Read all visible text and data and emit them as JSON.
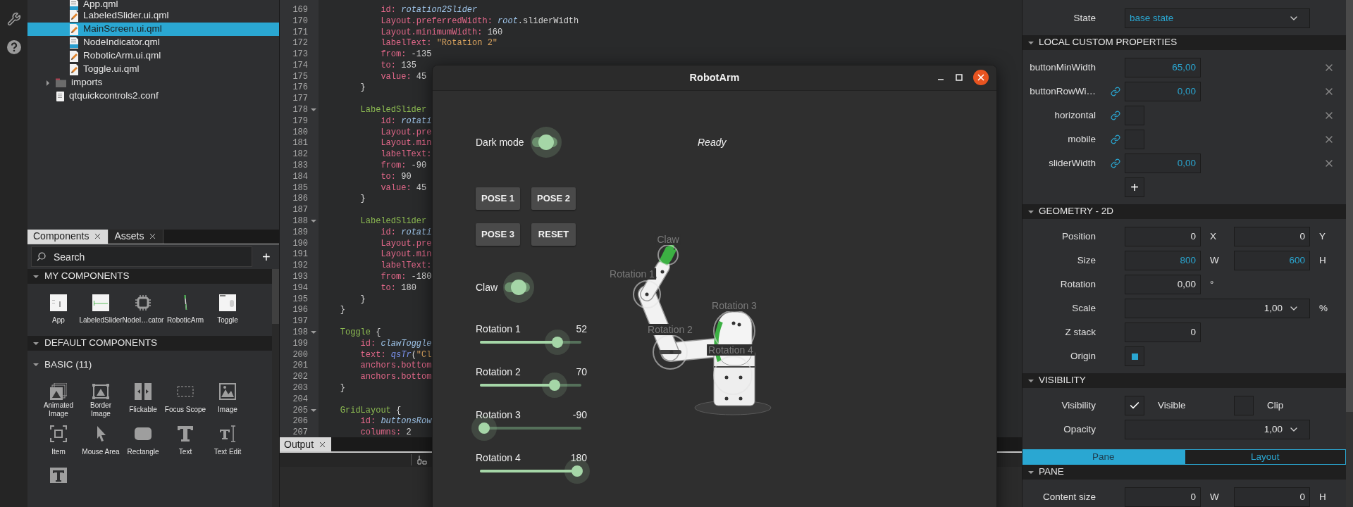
{
  "project_tree": {
    "nested_items": [
      {
        "label": "App.qml",
        "kind": "qml",
        "selected": false
      },
      {
        "label": "LabeledSlider.ui.qml",
        "kind": "uiqml",
        "selected": false
      },
      {
        "label": "MainScreen.ui.qml",
        "kind": "uiqml",
        "selected": true
      },
      {
        "label": "NodeIndicator.qml",
        "kind": "qml",
        "selected": false
      },
      {
        "label": "RoboticArm.ui.qml",
        "kind": "uiqml",
        "selected": false
      },
      {
        "label": "Toggle.ui.qml",
        "kind": "uiqml",
        "selected": false
      }
    ],
    "items": [
      {
        "label": "imports",
        "kind": "folder",
        "expanded": false,
        "selected": false
      },
      {
        "label": "qtquickcontrols2.conf",
        "kind": "file",
        "selected": false
      }
    ]
  },
  "library": {
    "tabs": [
      {
        "label": "Components",
        "selected": true
      },
      {
        "label": "Assets",
        "selected": false
      }
    ],
    "search": {
      "placeholder": "Search"
    },
    "add_button": "+",
    "sections": [
      {
        "title": "MY COMPONENTS",
        "expanded": true,
        "items": [
          {
            "label": "App",
            "kind": "app"
          },
          {
            "label": "LabeledSlider",
            "kind": "slider"
          },
          {
            "label": "NodeI…cator",
            "kind": "chip"
          },
          {
            "label": "RoboticArm",
            "kind": "arm"
          },
          {
            "label": "Toggle",
            "kind": "toggle"
          }
        ]
      },
      {
        "title": "DEFAULT COMPONENTS",
        "expanded": true,
        "groups": [
          {
            "title": "BASIC (11)",
            "expanded": true,
            "items": [
              {
                "label": "Animated Image",
                "kind": "animated-image"
              },
              {
                "label": "Border Image",
                "kind": "border-image"
              },
              {
                "label": "Flickable",
                "kind": "flickable"
              },
              {
                "label": "Focus Scope",
                "kind": "focus-scope"
              },
              {
                "label": "Image",
                "kind": "image"
              },
              {
                "label": "Item",
                "kind": "item"
              },
              {
                "label": "Mouse Area",
                "kind": "mouse-area"
              },
              {
                "label": "Rectangle",
                "kind": "rectangle"
              },
              {
                "label": "Text",
                "kind": "text"
              },
              {
                "label": "Text Edit",
                "kind": "text-edit"
              },
              {
                "kind": "text-input"
              }
            ]
          }
        ]
      }
    ]
  },
  "editor": {
    "lines": [
      {
        "n": "169",
        "fold": false,
        "tokens": [
          {
            "text": "            id:",
            "kind": "prop"
          },
          {
            "text": " rotation2Slider",
            "kind": "id"
          }
        ]
      },
      {
        "n": "170",
        "fold": false,
        "tokens": [
          {
            "text": "            Layout.preferredWidth:",
            "kind": "prop"
          },
          {
            "text": " root",
            "kind": "id"
          },
          {
            "text": ".sliderWidth",
            "kind": "plain"
          }
        ]
      },
      {
        "n": "171",
        "fold": false,
        "tokens": [
          {
            "text": "            Layout.minimumWidth:",
            "kind": "prop"
          },
          {
            "text": " 160",
            "kind": "plain"
          }
        ]
      },
      {
        "n": "172",
        "fold": false,
        "tokens": [
          {
            "text": "            labelText:",
            "kind": "prop"
          },
          {
            "text": " \"Rotation 2\"",
            "kind": "string"
          }
        ]
      },
      {
        "n": "173",
        "fold": false,
        "tokens": [
          {
            "text": "            from:",
            "kind": "prop"
          },
          {
            "text": " -135",
            "kind": "plain"
          }
        ]
      },
      {
        "n": "174",
        "fold": false,
        "tokens": [
          {
            "text": "            to:",
            "kind": "prop"
          },
          {
            "text": " 135",
            "kind": "plain"
          }
        ]
      },
      {
        "n": "175",
        "fold": false,
        "tokens": [
          {
            "text": "            value:",
            "kind": "prop"
          },
          {
            "text": " 45",
            "kind": "plain"
          }
        ]
      },
      {
        "n": "176",
        "fold": false,
        "tokens": [
          {
            "text": "        }",
            "kind": "plain"
          }
        ]
      },
      {
        "n": "177",
        "fold": false
      },
      {
        "n": "178",
        "fold": true,
        "tokens": [
          {
            "text": "        LabeledSlider",
            "kind": "type"
          }
        ]
      },
      {
        "n": "179",
        "fold": false,
        "tokens": [
          {
            "text": "            id:",
            "kind": "prop"
          },
          {
            "text": " rotati",
            "kind": "id"
          }
        ]
      },
      {
        "n": "180",
        "fold": false,
        "tokens": [
          {
            "text": "            Layout.pre",
            "kind": "prop"
          }
        ]
      },
      {
        "n": "181",
        "fold": false,
        "tokens": [
          {
            "text": "            Layout.min",
            "kind": "prop"
          }
        ]
      },
      {
        "n": "182",
        "fold": false,
        "tokens": [
          {
            "text": "            labelText:",
            "kind": "prop"
          }
        ]
      },
      {
        "n": "183",
        "fold": false,
        "tokens": [
          {
            "text": "            from:",
            "kind": "prop"
          },
          {
            "text": " -90",
            "kind": "plain"
          }
        ]
      },
      {
        "n": "184",
        "fold": false,
        "tokens": [
          {
            "text": "            to:",
            "kind": "prop"
          },
          {
            "text": " 90",
            "kind": "plain"
          }
        ]
      },
      {
        "n": "185",
        "fold": false,
        "tokens": [
          {
            "text": "            value:",
            "kind": "prop"
          },
          {
            "text": " 45",
            "kind": "plain"
          }
        ]
      },
      {
        "n": "186",
        "fold": false,
        "tokens": [
          {
            "text": "        }",
            "kind": "plain"
          }
        ]
      },
      {
        "n": "187",
        "fold": false
      },
      {
        "n": "188",
        "fold": true,
        "tokens": [
          {
            "text": "        LabeledSlider",
            "kind": "type"
          }
        ]
      },
      {
        "n": "189",
        "fold": false,
        "tokens": [
          {
            "text": "            id:",
            "kind": "prop"
          },
          {
            "text": " rotati",
            "kind": "id"
          }
        ]
      },
      {
        "n": "190",
        "fold": false,
        "tokens": [
          {
            "text": "            Layout.pre",
            "kind": "prop"
          }
        ]
      },
      {
        "n": "191",
        "fold": false,
        "tokens": [
          {
            "text": "            Layout.min",
            "kind": "prop"
          }
        ]
      },
      {
        "n": "192",
        "fold": false,
        "tokens": [
          {
            "text": "            labelText:",
            "kind": "prop"
          }
        ]
      },
      {
        "n": "193",
        "fold": false,
        "tokens": [
          {
            "text": "            from:",
            "kind": "prop"
          },
          {
            "text": " -180",
            "kind": "plain"
          }
        ]
      },
      {
        "n": "194",
        "fold": false,
        "tokens": [
          {
            "text": "            to:",
            "kind": "prop"
          },
          {
            "text": " 180",
            "kind": "plain"
          }
        ]
      },
      {
        "n": "195",
        "fold": false,
        "tokens": [
          {
            "text": "        }",
            "kind": "plain"
          }
        ]
      },
      {
        "n": "196",
        "fold": false,
        "tokens": [
          {
            "text": "    }",
            "kind": "plain"
          }
        ]
      },
      {
        "n": "197",
        "fold": false
      },
      {
        "n": "198",
        "fold": true,
        "tokens": [
          {
            "text": "    Toggle",
            "kind": "type"
          },
          {
            "text": " {",
            "kind": "plain"
          }
        ]
      },
      {
        "n": "199",
        "fold": false,
        "tokens": [
          {
            "text": "        id:",
            "kind": "prop"
          },
          {
            "text": " clawToggle",
            "kind": "id"
          }
        ]
      },
      {
        "n": "200",
        "fold": false,
        "tokens": [
          {
            "text": "        text:",
            "kind": "prop"
          },
          {
            "text": " qsTr",
            "kind": "func"
          },
          {
            "text": "(",
            "kind": "plain"
          },
          {
            "text": "\"Cl",
            "kind": "string"
          }
        ]
      },
      {
        "n": "201",
        "fold": false,
        "tokens": [
          {
            "text": "        anchors.bottom",
            "kind": "prop"
          }
        ]
      },
      {
        "n": "202",
        "fold": false,
        "tokens": [
          {
            "text": "        anchors.bottom",
            "kind": "prop"
          }
        ]
      },
      {
        "n": "203",
        "fold": false,
        "tokens": [
          {
            "text": "    }",
            "kind": "plain"
          }
        ]
      },
      {
        "n": "204",
        "fold": false
      },
      {
        "n": "205",
        "fold": true,
        "tokens": [
          {
            "text": "    GridLayout",
            "kind": "type"
          },
          {
            "text": " {",
            "kind": "plain"
          }
        ]
      },
      {
        "n": "206",
        "fold": false,
        "tokens": [
          {
            "text": "        id:",
            "kind": "prop"
          },
          {
            "text": " buttonsRow",
            "kind": "id"
          }
        ]
      },
      {
        "n": "207",
        "fold": false,
        "tokens": [
          {
            "text": "        columns:",
            "kind": "prop"
          },
          {
            "text": " 2",
            "kind": "plain"
          }
        ]
      }
    ],
    "output_tab": {
      "label": "Output",
      "selected": true
    }
  },
  "robot_window": {
    "title": "RobotArm",
    "dark_mode": {
      "label": "Dark mode",
      "on": true
    },
    "status": "Ready",
    "buttons": [
      "POSE 1",
      "POSE 2",
      "POSE 3",
      "RESET"
    ],
    "claw": {
      "label": "Claw",
      "on": true
    },
    "sliders": [
      {
        "label": "Rotation 1",
        "reading": "52",
        "level": 0.79
      },
      {
        "label": "Rotation 2",
        "reading": "70",
        "level": 0.76
      },
      {
        "label": "Rotation 3",
        "reading": "-90",
        "level": 0
      },
      {
        "label": "Rotation 4",
        "reading": "180",
        "level": 1
      }
    ],
    "node_labels": [
      "Claw",
      "Rotation 1",
      "Rotation 2",
      "Rotation 3",
      "Rotation 4"
    ]
  },
  "properties": {
    "state": {
      "label": "State",
      "value": "base state"
    },
    "sections": [
      {
        "title": "LOCAL CUSTOM PROPERTIES",
        "expanded": true,
        "rows": [
          {
            "label": "buttonMinWidth",
            "kind": "number",
            "value": "65,00",
            "bound": false
          },
          {
            "label": "buttonRowWi…",
            "kind": "number",
            "value": "0,00",
            "bound": true
          },
          {
            "label": "horizontal",
            "kind": "checkbox",
            "checked": false,
            "bound": true
          },
          {
            "label": "mobile",
            "kind": "checkbox",
            "checked": false,
            "bound": true
          },
          {
            "label": "sliderWidth",
            "kind": "number",
            "value": "0,00",
            "bound": true
          },
          {
            "kind": "add",
            "value": "+"
          }
        ]
      },
      {
        "title": "GEOMETRY - 2D",
        "expanded": true,
        "rows": [
          {
            "label": "Position",
            "kind": "pair",
            "fields": [
              {
                "value": "0",
                "unit": "X",
                "highlighted": false
              },
              {
                "value": "0",
                "unit": "Y",
                "highlighted": false
              }
            ]
          },
          {
            "label": "Size",
            "kind": "pair",
            "fields": [
              {
                "value": "800",
                "unit": "W",
                "highlighted": true
              },
              {
                "value": "600",
                "unit": "H",
                "highlighted": true
              }
            ]
          },
          {
            "label": "Rotation",
            "kind": "single",
            "fields": [
              {
                "value": "0,00",
                "unit": "°",
                "highlighted": false
              }
            ]
          },
          {
            "label": "Scale",
            "kind": "combo",
            "fields": [
              {
                "value": "1,00",
                "unit": "%",
                "highlighted": false
              }
            ]
          },
          {
            "label": "Z stack",
            "kind": "single",
            "fields": [
              {
                "value": "0",
                "highlighted": false
              }
            ]
          },
          {
            "label": "Origin",
            "kind": "origin"
          }
        ]
      },
      {
        "title": "VISIBILITY",
        "expanded": true,
        "rows": [
          {
            "label": "Visibility",
            "kind": "checks",
            "checks": [
              {
                "label": "Visible",
                "checked": true
              },
              {
                "label": "Clip",
                "checked": false
              }
            ]
          },
          {
            "label": "Opacity",
            "kind": "combo",
            "fields": [
              {
                "value": "1,00",
                "highlighted": false
              }
            ]
          }
        ]
      }
    ],
    "tabs": [
      {
        "label": "Pane",
        "selected": true
      },
      {
        "label": "Layout",
        "selected": false
      }
    ],
    "pane_sections": [
      {
        "title": "PANE",
        "expanded": true,
        "rows": [
          {
            "label": "Content size",
            "kind": "pair",
            "fields": [
              {
                "value": "0",
                "unit": "W",
                "highlighted": false
              },
              {
                "value": "0",
                "unit": "H",
                "highlighted": false
              }
            ]
          }
        ]
      }
    ]
  }
}
